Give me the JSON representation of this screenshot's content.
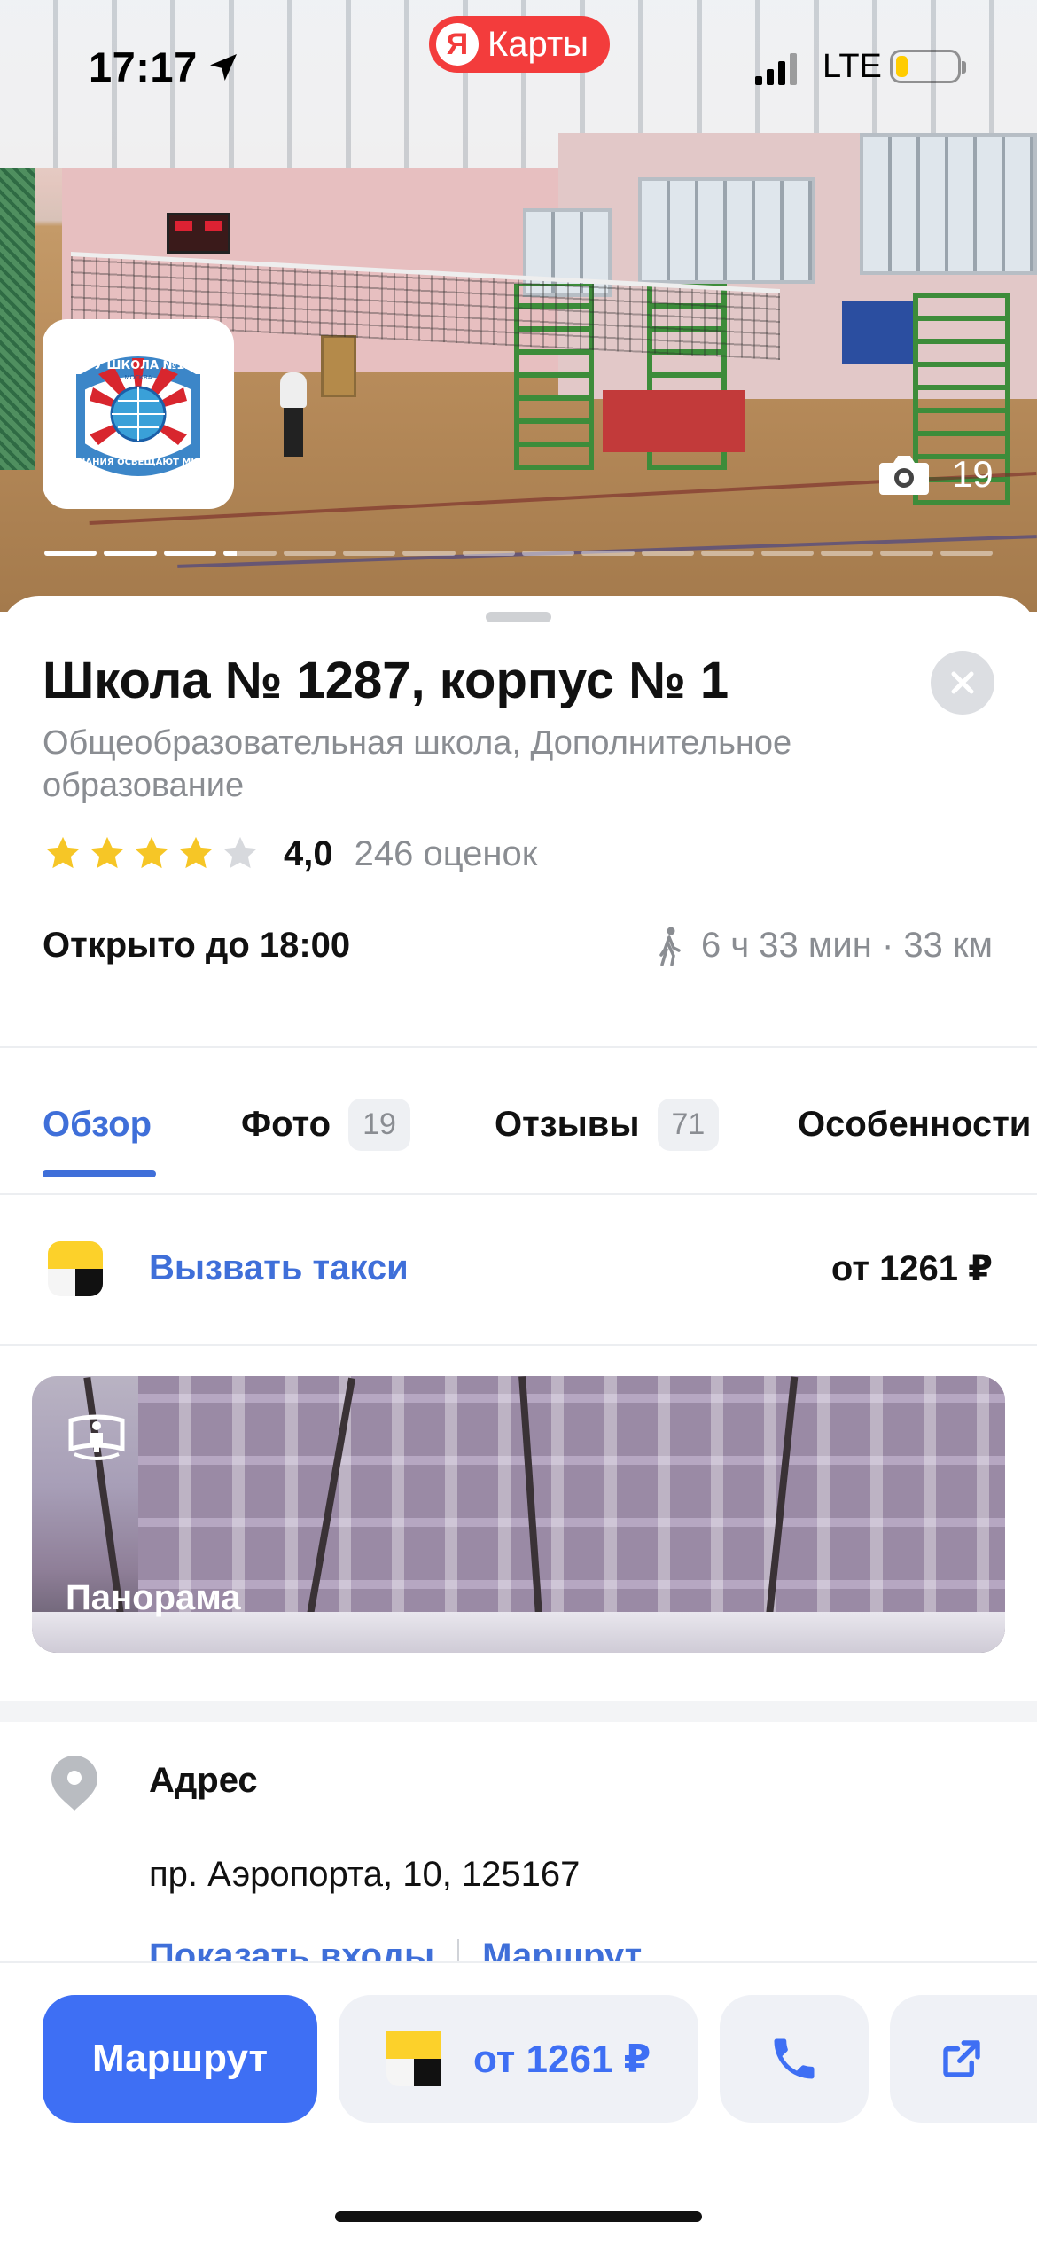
{
  "status_bar": {
    "time": "17:17",
    "network": "LTE",
    "battery_level": 0.2,
    "app_badge": {
      "logo_letter": "Я",
      "name": "Карты"
    }
  },
  "hero": {
    "photo_count": "19",
    "gallery_total": 16,
    "gallery_current": 4
  },
  "place": {
    "title": "Школа № 1287, корпус № 1",
    "category": "Общеобразовательная школа, Дополнительное образование",
    "rating_value": "4,0",
    "rating_stars": 4,
    "rating_count": "246 оценок",
    "open_status": "Открыто до 18:00",
    "walk_time": "6 ч 33 мин",
    "distance_sep": "·",
    "distance": "33 км",
    "logo": {
      "top_text": "ГБОУ ШКОЛА №1287",
      "city_text": "МОСКВА",
      "motto": "ЗНАНИЯ ОСВЕЩАЮТ МИР"
    }
  },
  "tabs": [
    {
      "label": "Обзор",
      "badge": "",
      "active": true
    },
    {
      "label": "Фото",
      "badge": "19",
      "active": false
    },
    {
      "label": "Отзывы",
      "badge": "71",
      "active": false
    },
    {
      "label": "Особенности",
      "badge": "",
      "active": false
    }
  ],
  "taxi": {
    "label": "Вызвать такси",
    "price": "от 1261 ₽"
  },
  "panorama": {
    "label": "Панорама"
  },
  "address": {
    "title": "Адрес",
    "value": "пр. Аэропорта, 10, 125167",
    "link_entrances": "Показать входы",
    "link_route": "Маршрут"
  },
  "actions": {
    "route_label": "Маршрут",
    "taxi_price": "от 1261 ₽"
  },
  "colors": {
    "accent": "#3e6ff4",
    "link": "#3f6fd9",
    "star": "#f6c626",
    "star_empty": "#d7d9dd",
    "brand_red": "#f33c3c"
  }
}
